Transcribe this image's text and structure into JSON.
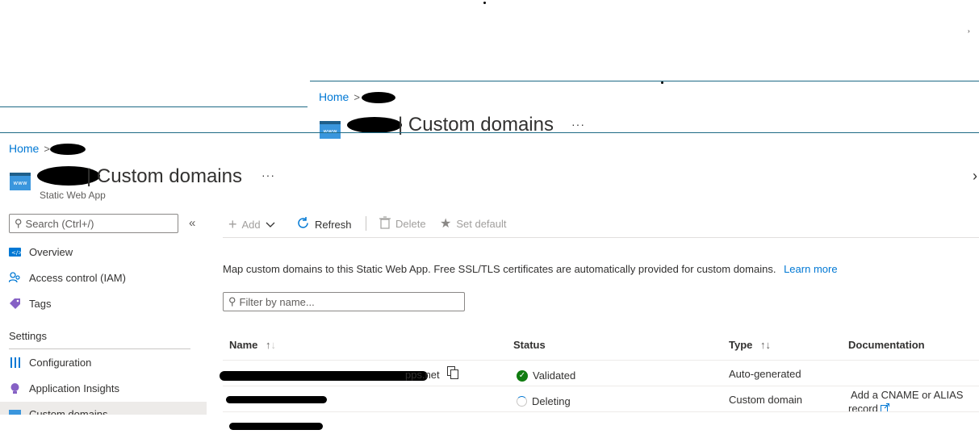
{
  "background_panel": {
    "breadcrumb_home": "Home",
    "title": "| Custom domains",
    "more": "···"
  },
  "breadcrumb": {
    "home": "Home"
  },
  "header": {
    "title": "| Custom domains",
    "more": "···",
    "subtitle": "Static Web App",
    "icon_text": "www"
  },
  "sidebar": {
    "search_placeholder": "Search (Ctrl+/)",
    "collapse": "«",
    "items": [
      {
        "label": "Overview"
      },
      {
        "label": "Access control (IAM)"
      },
      {
        "label": "Tags"
      }
    ],
    "section_settings": "Settings",
    "settings_items": [
      {
        "label": "Configuration"
      },
      {
        "label": "Application Insights"
      },
      {
        "label": "Custom domains"
      }
    ]
  },
  "toolbar": {
    "add": "Add",
    "refresh": "Refresh",
    "delete": "Delete",
    "set_default": "Set default"
  },
  "main": {
    "description": "Map custom domains to this Static Web App. Free SSL/TLS certificates are automatically provided for custom domains.",
    "learn_more": "Learn more",
    "filter_placeholder": "Filter by name..."
  },
  "table": {
    "columns": [
      "Name",
      "Status",
      "Type",
      "Documentation"
    ],
    "rows": [
      {
        "name_suffix": "pps.net",
        "status": "Validated",
        "type": "Auto-generated",
        "doc": ""
      },
      {
        "name_suffix": "",
        "status": "Deleting",
        "type": "Custom domain",
        "doc_line1": "Add a CNAME or ALIAS",
        "doc_line2": "record"
      }
    ]
  },
  "colors": {
    "accent": "#0078d4",
    "success": "#107c10",
    "divider": "#1e6a85"
  }
}
